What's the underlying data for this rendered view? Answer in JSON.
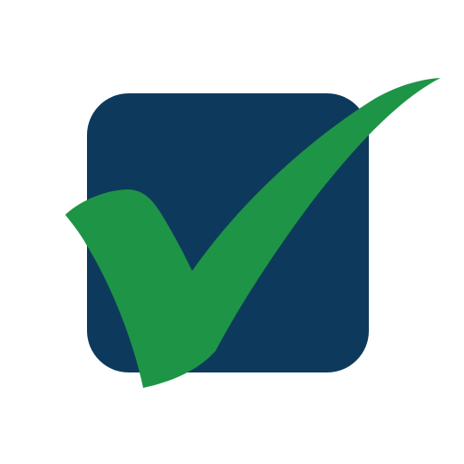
{
  "icon": {
    "name": "checkbox-checked-icon",
    "colors": {
      "background": "#ffffff",
      "box": "#0d3a5c",
      "checkmark": "#1e9446"
    }
  }
}
